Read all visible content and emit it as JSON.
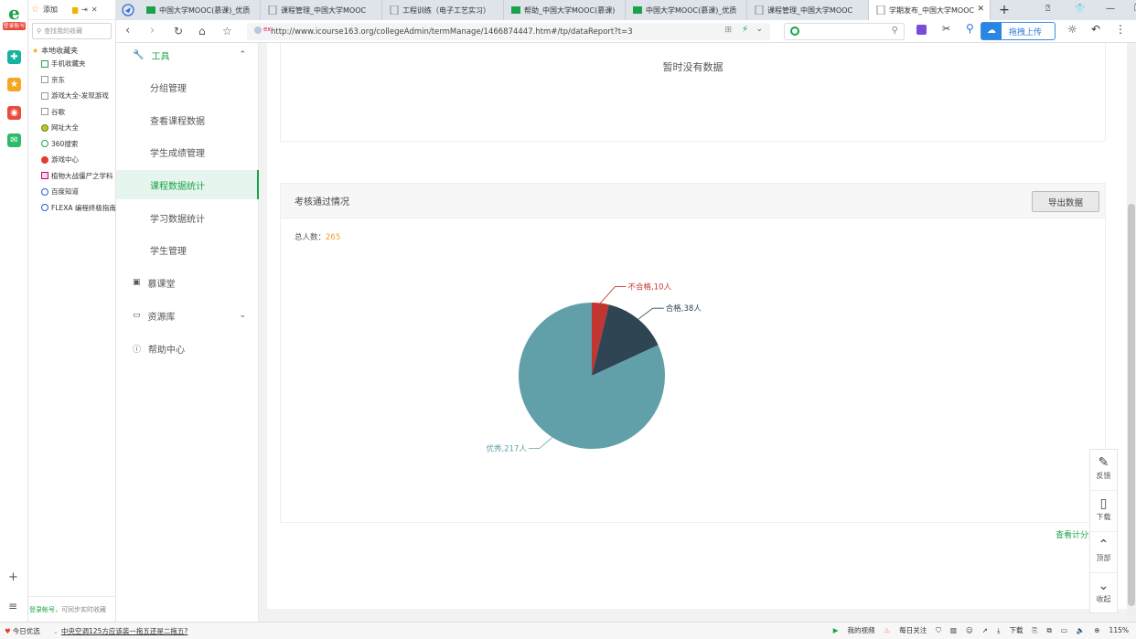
{
  "browser": {
    "rail_tag": "登录账号",
    "favorites": {
      "add_label": "添加",
      "search_placeholder": "查找我的收藏",
      "root_label": "本地收藏夹",
      "items": [
        "手机收藏夹",
        "京东",
        "游戏大全-发现游戏",
        "谷歌",
        "网址大全",
        "360搜索",
        "游戏中心",
        "植物大战僵尸之学科",
        "百度知道",
        "FLEXA 编程终极指南"
      ],
      "login_label": "登录帐号",
      "login_hint": "，可同步实时收藏"
    },
    "tabs": [
      {
        "title": "中国大学MOOC(慕课)_优质",
        "icon": "mooc-icon",
        "active": false
      },
      {
        "title": "课程管理_中国大学MOOC",
        "icon": "page-icon",
        "active": false
      },
      {
        "title": "工程训练（电子工艺实习）",
        "icon": "page-icon",
        "active": false
      },
      {
        "title": "帮助_中国大学MOOC(慕课)",
        "icon": "mooc-icon",
        "active": false
      },
      {
        "title": "中国大学MOOC(慕课)_优质",
        "icon": "mooc-icon",
        "active": false
      },
      {
        "title": "课程管理_中国大学MOOC",
        "icon": "page-icon",
        "active": false
      },
      {
        "title": "学期发布_中国大学MOOC",
        "icon": "page-icon",
        "active": true
      }
    ],
    "url": "http://www.icourse163.org/collegeAdmin/termManage/1466874447.htm#/tp/dataReport?t=3",
    "upload_label": "拖拽上传",
    "status": {
      "left_label": "今日优选",
      "news": "中央空调125方应该装一拖五还是二拖五?",
      "video": "我的视频",
      "follow": "每日关注",
      "download": "下载",
      "zoom": "115%"
    }
  },
  "sidebar": {
    "tools_label": "工具",
    "sub_items": [
      "分组管理",
      "查看课程数据",
      "学生成绩管理",
      "课程数据统计",
      "学习数据统计",
      "学生管理"
    ],
    "active_index": 3,
    "sections": [
      "慕课堂",
      "资源库",
      "帮助中心"
    ]
  },
  "main": {
    "no_data": "暂时没有数据",
    "panel_title": "考核通过情况",
    "export_label": "导出数据",
    "total_label": "总人数：",
    "total_value": "265",
    "view_more": "查看计分规则"
  },
  "float_toolbar": [
    "反馈",
    "下载",
    "顶部",
    "收起"
  ],
  "chart_data": {
    "type": "pie",
    "slices": [
      {
        "label": "不合格,10人",
        "name": "不合格",
        "value": 10,
        "color": "#c23531"
      },
      {
        "label": "合格,38人",
        "name": "合格",
        "value": 38,
        "color": "#2f4554"
      },
      {
        "label": "优秀,217人",
        "name": "优秀",
        "value": 217,
        "color": "#61a0a8"
      }
    ]
  }
}
